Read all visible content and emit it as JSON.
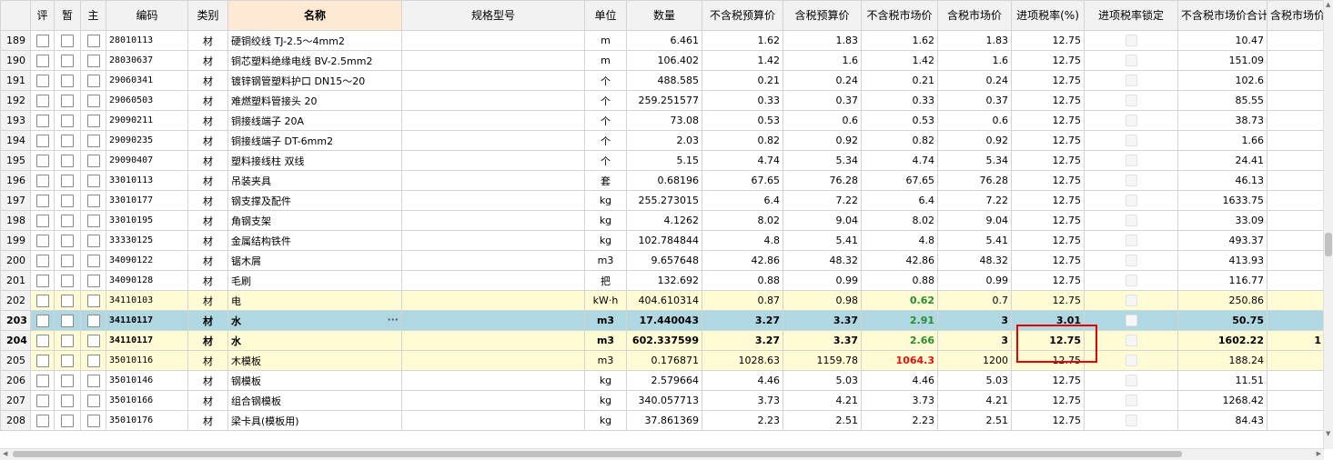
{
  "headers": [
    "",
    "评",
    "暂",
    "主",
    "编码",
    "类别",
    "名称",
    "规格型号",
    "单位",
    "数量",
    "不含税预算价",
    "含税预算价",
    "不含税市场价",
    "含税市场价",
    "进项税率(%)",
    "进项税率锁定",
    "不含税市场价合计",
    "含税市场价"
  ],
  "rows": [
    {
      "no": "189",
      "code": "28010113",
      "cat": "材",
      "name": "硬铜绞线 TJ-2.5～4mm2",
      "unit": "m",
      "qty": "6.461",
      "p1": "1.62",
      "p2": "1.83",
      "p3": "1.62",
      "p4": "1.83",
      "tax": "12.75",
      "total": "10.47",
      "style": "normal",
      "p3s": ""
    },
    {
      "no": "190",
      "code": "28030637",
      "cat": "材",
      "name": "铜芯塑料绝缘电线 BV-2.5mm2",
      "unit": "m",
      "qty": "106.402",
      "p1": "1.42",
      "p2": "1.6",
      "p3": "1.42",
      "p4": "1.6",
      "tax": "12.75",
      "total": "151.09",
      "style": "normal",
      "p3s": ""
    },
    {
      "no": "191",
      "code": "29060341",
      "cat": "材",
      "name": "镀锌钢管塑料护口 DN15～20",
      "unit": "个",
      "qty": "488.585",
      "p1": "0.21",
      "p2": "0.24",
      "p3": "0.21",
      "p4": "0.24",
      "tax": "12.75",
      "total": "102.6",
      "style": "normal",
      "p3s": ""
    },
    {
      "no": "192",
      "code": "29060503",
      "cat": "材",
      "name": "难燃塑料管接头 20",
      "unit": "个",
      "qty": "259.251577",
      "p1": "0.33",
      "p2": "0.37",
      "p3": "0.33",
      "p4": "0.37",
      "tax": "12.75",
      "total": "85.55",
      "style": "normal",
      "p3s": ""
    },
    {
      "no": "193",
      "code": "29090211",
      "cat": "材",
      "name": "铜接线端子 20A",
      "unit": "个",
      "qty": "73.08",
      "p1": "0.53",
      "p2": "0.6",
      "p3": "0.53",
      "p4": "0.6",
      "tax": "12.75",
      "total": "38.73",
      "style": "normal",
      "p3s": ""
    },
    {
      "no": "194",
      "code": "29090235",
      "cat": "材",
      "name": "铜接线端子 DT-6mm2",
      "unit": "个",
      "qty": "2.03",
      "p1": "0.82",
      "p2": "0.92",
      "p3": "0.82",
      "p4": "0.92",
      "tax": "12.75",
      "total": "1.66",
      "style": "normal",
      "p3s": ""
    },
    {
      "no": "195",
      "code": "29090407",
      "cat": "材",
      "name": "塑料接线柱 双线",
      "unit": "个",
      "qty": "5.15",
      "p1": "4.74",
      "p2": "5.34",
      "p3": "4.74",
      "p4": "5.34",
      "tax": "12.75",
      "total": "24.41",
      "style": "normal",
      "p3s": ""
    },
    {
      "no": "196",
      "code": "33010113",
      "cat": "材",
      "name": "吊装夹具",
      "unit": "套",
      "qty": "0.68196",
      "p1": "67.65",
      "p2": "76.28",
      "p3": "67.65",
      "p4": "76.28",
      "tax": "12.75",
      "total": "46.13",
      "style": "normal",
      "p3s": ""
    },
    {
      "no": "197",
      "code": "33010177",
      "cat": "材",
      "name": "钢支撑及配件",
      "unit": "kg",
      "qty": "255.273015",
      "p1": "6.4",
      "p2": "7.22",
      "p3": "6.4",
      "p4": "7.22",
      "tax": "12.75",
      "total": "1633.75",
      "style": "normal",
      "p3s": ""
    },
    {
      "no": "198",
      "code": "33010195",
      "cat": "材",
      "name": "角钢支架",
      "unit": "kg",
      "qty": "4.1262",
      "p1": "8.02",
      "p2": "9.04",
      "p3": "8.02",
      "p4": "9.04",
      "tax": "12.75",
      "total": "33.09",
      "style": "normal",
      "p3s": ""
    },
    {
      "no": "199",
      "code": "33330125",
      "cat": "材",
      "name": "金属结构铁件",
      "unit": "kg",
      "qty": "102.784844",
      "p1": "4.8",
      "p2": "5.41",
      "p3": "4.8",
      "p4": "5.41",
      "tax": "12.75",
      "total": "493.37",
      "style": "normal",
      "p3s": ""
    },
    {
      "no": "200",
      "code": "34090122",
      "cat": "材",
      "name": "锯木屑",
      "unit": "m3",
      "qty": "9.657648",
      "p1": "42.86",
      "p2": "48.32",
      "p3": "42.86",
      "p4": "48.32",
      "tax": "12.75",
      "total": "413.93",
      "style": "normal",
      "p3s": ""
    },
    {
      "no": "201",
      "code": "34090128",
      "cat": "材",
      "name": "毛刷",
      "unit": "把",
      "qty": "132.692",
      "p1": "0.88",
      "p2": "0.99",
      "p3": "0.88",
      "p4": "0.99",
      "tax": "12.75",
      "total": "116.77",
      "style": "normal",
      "p3s": ""
    },
    {
      "no": "202",
      "code": "34110103",
      "cat": "材",
      "name": "电",
      "unit": "kW·h",
      "qty": "404.610314",
      "p1": "0.87",
      "p2": "0.98",
      "p3": "0.62",
      "p4": "0.7",
      "tax": "12.75",
      "total": "250.86",
      "style": "yellow",
      "p3s": "green"
    },
    {
      "no": "203",
      "code": "34110117",
      "cat": "材",
      "name": "水",
      "unit": "m3",
      "qty": "17.440043",
      "p1": "3.27",
      "p2": "3.37",
      "p3": "2.91",
      "p4": "3",
      "tax": "3.01",
      "total": "50.75",
      "style": "sel",
      "p3s": "green",
      "extra": ""
    },
    {
      "no": "204",
      "code": "34110117",
      "cat": "材",
      "name": "水",
      "unit": "m3",
      "qty": "602.337599",
      "p1": "3.27",
      "p2": "3.37",
      "p3": "2.66",
      "p4": "3",
      "tax": "12.75",
      "total": "1602.22",
      "style": "yellowbold",
      "p3s": "green",
      "extra": "1"
    },
    {
      "no": "205",
      "code": "35010116",
      "cat": "材",
      "name": "木模板",
      "unit": "m3",
      "qty": "0.176871",
      "p1": "1028.63",
      "p2": "1159.78",
      "p3": "1064.3",
      "p4": "1200",
      "tax": "12.75",
      "total": "188.24",
      "style": "yellow",
      "p3s": "red"
    },
    {
      "no": "206",
      "code": "35010146",
      "cat": "材",
      "name": "钢模板",
      "unit": "kg",
      "qty": "2.579664",
      "p1": "4.46",
      "p2": "5.03",
      "p3": "4.46",
      "p4": "5.03",
      "tax": "12.75",
      "total": "11.51",
      "style": "normal",
      "p3s": ""
    },
    {
      "no": "207",
      "code": "35010166",
      "cat": "材",
      "name": "组合钢模板",
      "unit": "kg",
      "qty": "340.057713",
      "p1": "3.73",
      "p2": "4.21",
      "p3": "3.73",
      "p4": "4.21",
      "tax": "12.75",
      "total": "1268.42",
      "style": "normal",
      "p3s": ""
    },
    {
      "no": "208",
      "code": "35010176",
      "cat": "材",
      "name": "梁卡具(模板用)",
      "unit": "kg",
      "qty": "37.861369",
      "p1": "2.23",
      "p2": "2.51",
      "p3": "2.23",
      "p4": "2.51",
      "tax": "12.75",
      "total": "84.43",
      "style": "normal",
      "p3s": ""
    }
  ],
  "ellipsis": "···"
}
